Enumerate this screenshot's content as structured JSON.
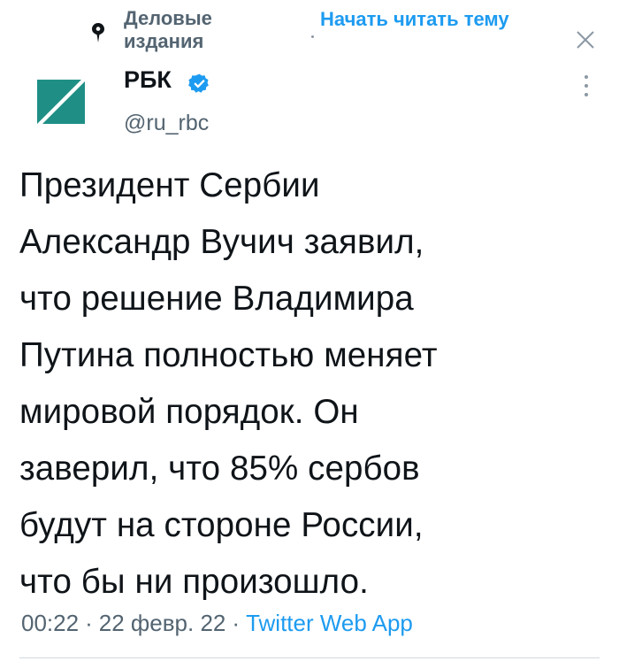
{
  "topic": {
    "label_line1": "Деловые",
    "label_line2": "издания",
    "follow_label": "Начать читать тему",
    "icons": {
      "topic": "location-pin-icon",
      "dismiss": "close-icon"
    }
  },
  "author": {
    "name": "РБК",
    "handle": "@ru_rbc",
    "verified": true,
    "avatar_colors": {
      "background": "#1f8f86",
      "accent": "#ffffff"
    }
  },
  "tweet": {
    "text_lines": [
      "Президент Сербии",
      "Александр Вучич заявил,",
      "что решение Владимира",
      "Путина полностью меняет",
      "мировой порядок. Он",
      "заверил, что 85% сербов",
      "будут на стороне России,",
      "что бы ни произошло."
    ],
    "time": "00:22",
    "date": "22 февр. 22",
    "separator": "·",
    "source": "Twitter Web App"
  },
  "colors": {
    "link_blue": "#1d9bf0",
    "secondary_text": "#536471",
    "text": "#0f1419"
  }
}
